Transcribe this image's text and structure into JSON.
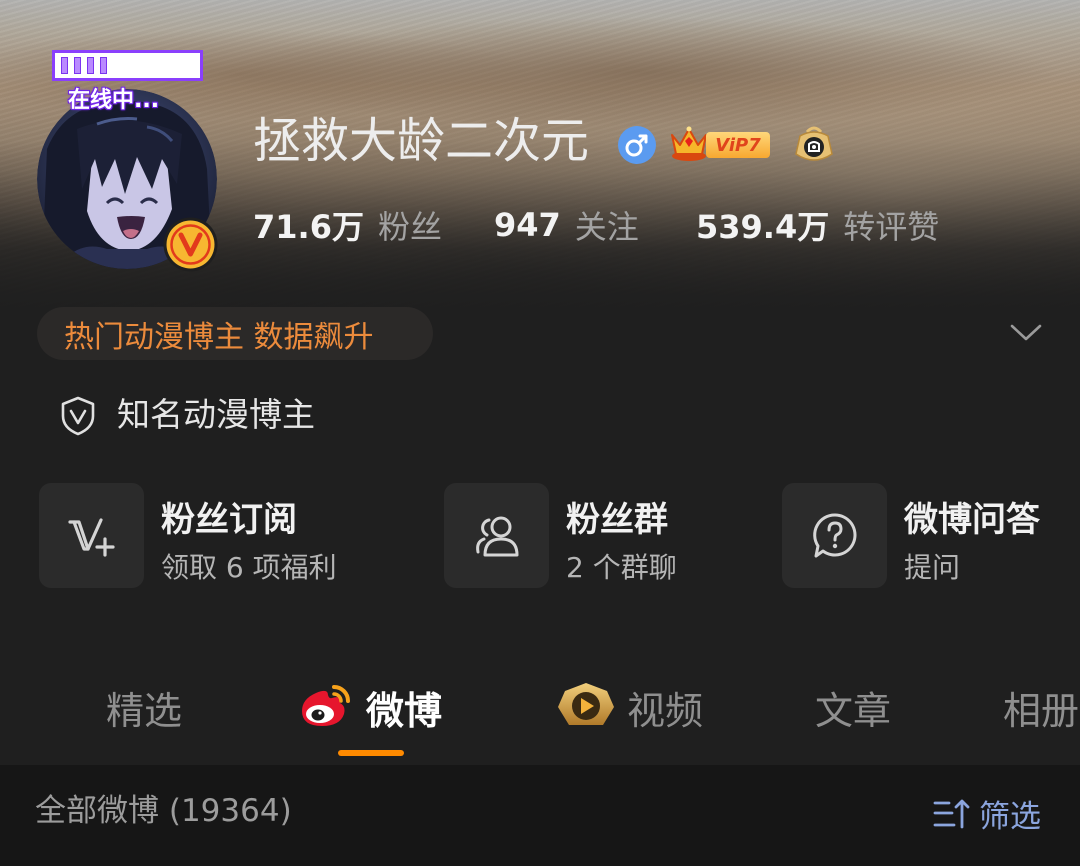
{
  "profile": {
    "online_badge": "在线中...",
    "username": "拯救大龄二次元",
    "vip_label": "ViP7",
    "stats": [
      {
        "value": "71.6万",
        "label": "粉丝"
      },
      {
        "value": "947",
        "label": "关注"
      },
      {
        "value": "539.4万",
        "label": "转评赞"
      }
    ],
    "highlight_pill": "热门动漫博主 数据飙升",
    "verification": "知名动漫博主",
    "icons": [
      "avatar",
      "verified-v-icon",
      "male-gender-icon",
      "vip-crown-icon",
      "fan-badge-icon",
      "chevron-down-icon",
      "shield-v-icon"
    ]
  },
  "cards": [
    {
      "title": "粉丝订阅",
      "subtitle": "领取 6 项福利",
      "icon": "v-plus-icon"
    },
    {
      "title": "粉丝群",
      "subtitle": "2 个群聊",
      "icon": "fan-group-icon"
    },
    {
      "title": "微博问答",
      "subtitle": "提问",
      "icon": "question-bubble-icon"
    }
  ],
  "tabs": [
    {
      "label": "精选",
      "active": false
    },
    {
      "label": "微博",
      "active": true,
      "icon": "weibo-logo-icon"
    },
    {
      "label": "视频",
      "active": false,
      "icon": "video-channel-icon"
    },
    {
      "label": "文章",
      "active": false
    },
    {
      "label": "相册",
      "active": false
    }
  ],
  "feed_header": {
    "count_label": "全部微博 (19364)",
    "filter_label": "筛选",
    "filter_icon": "filter-sort-icon"
  },
  "colors": {
    "background": "#1f1f1f",
    "feed_header_background": "#161616",
    "tile_background": "#2b2b2b",
    "accent": "#ff8a00",
    "highlight_text": "#ec8b3c",
    "link": "#8ba5de",
    "gender_male": "#5b9bf0"
  }
}
